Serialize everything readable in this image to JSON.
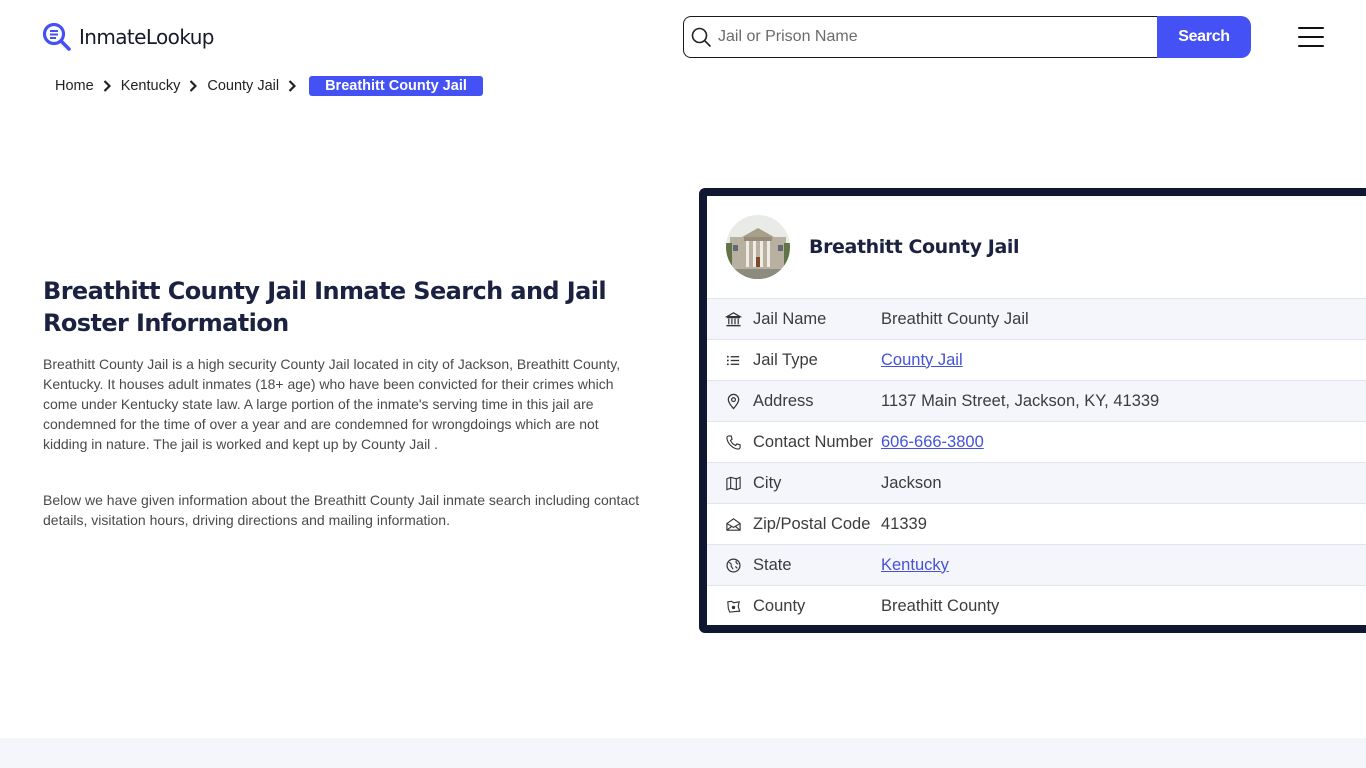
{
  "header": {
    "logo_text": "InmateLookup",
    "search": {
      "placeholder": "Jail or Prison Name",
      "value": "",
      "button_label": "Search"
    },
    "menu_icon": "hamburger-menu-icon"
  },
  "breadcrumb": {
    "items": [
      "Home",
      "Kentucky",
      "County Jail"
    ],
    "current": "Breathitt County Jail"
  },
  "main": {
    "title": "Breathitt County Jail Inmate Search and Jail Roster Information",
    "paragraphs": [
      "Breathitt County Jail is a high security County Jail located in city of Jackson, Breathitt County, Kentucky. It houses adult inmates (18+ age) who have been convicted for their crimes which come under Kentucky state law. A large portion of the inmate's serving time in this jail are condemned for the time of over a year and are condemned for wrongdoings which are not kidding in nature. The jail is worked and kept up by County Jail .",
      "Below we have given information about the Breathitt County Jail inmate search including contact details, visitation hours, driving directions and mailing information."
    ]
  },
  "card": {
    "title": "Breathitt County Jail",
    "rows": [
      {
        "icon": "building-columns-icon",
        "label": "Jail Name",
        "value": "Breathitt County Jail",
        "link": false
      },
      {
        "icon": "list-icon",
        "label": "Jail Type",
        "value": "County Jail",
        "link": true
      },
      {
        "icon": "map-pin-icon",
        "label": "Address",
        "value": "1137 Main Street, Jackson, KY, 41339",
        "link": false
      },
      {
        "icon": "phone-icon",
        "label": "Contact Number",
        "value": "606-666-3800",
        "link": true
      },
      {
        "icon": "map-icon",
        "label": "City",
        "value": "Jackson",
        "link": false
      },
      {
        "icon": "mail-open-icon",
        "label": "Zip/Postal Code",
        "value": "41339",
        "link": false
      },
      {
        "icon": "globe-icon",
        "label": "State",
        "value": "Kentucky",
        "link": true
      },
      {
        "icon": "county-map-icon",
        "label": "County",
        "value": "Breathitt County",
        "link": false
      }
    ]
  },
  "colors": {
    "accent": "#4452f5",
    "card_border": "#0f1830",
    "link": "#4452d9",
    "row_alt": "#f5f6fc"
  }
}
